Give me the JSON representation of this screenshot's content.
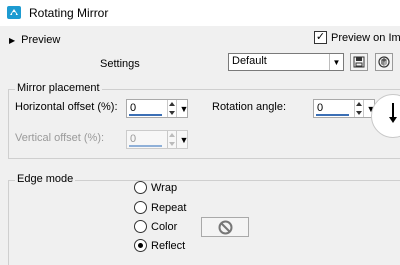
{
  "window": {
    "title": "Rotating Mirror",
    "app_icon": "paint-shop-pro-icon"
  },
  "preview": {
    "toggle_label": "Preview",
    "preview_on_image_label": "Preview on Ima",
    "preview_on_image_checked": true
  },
  "settings": {
    "label": "Settings",
    "preset_value": "Default",
    "save_icon": "save-icon",
    "reset_icon": "reset-preset-icon"
  },
  "mirror_placement": {
    "title": "Mirror placement",
    "horizontal_offset_label": "Horizontal offset (%):",
    "horizontal_offset_value": "0",
    "vertical_offset_label": "Vertical offset (%):",
    "vertical_offset_value": "0",
    "rotation_angle_label": "Rotation angle:",
    "rotation_angle_value": "0"
  },
  "edge_mode": {
    "title": "Edge mode",
    "options": [
      {
        "label": "Wrap",
        "selected": false
      },
      {
        "label": "Repeat",
        "selected": false
      },
      {
        "label": "Color",
        "selected": false
      },
      {
        "label": "Reflect",
        "selected": true
      }
    ],
    "color_swatch_icon": "no-color-icon"
  }
}
